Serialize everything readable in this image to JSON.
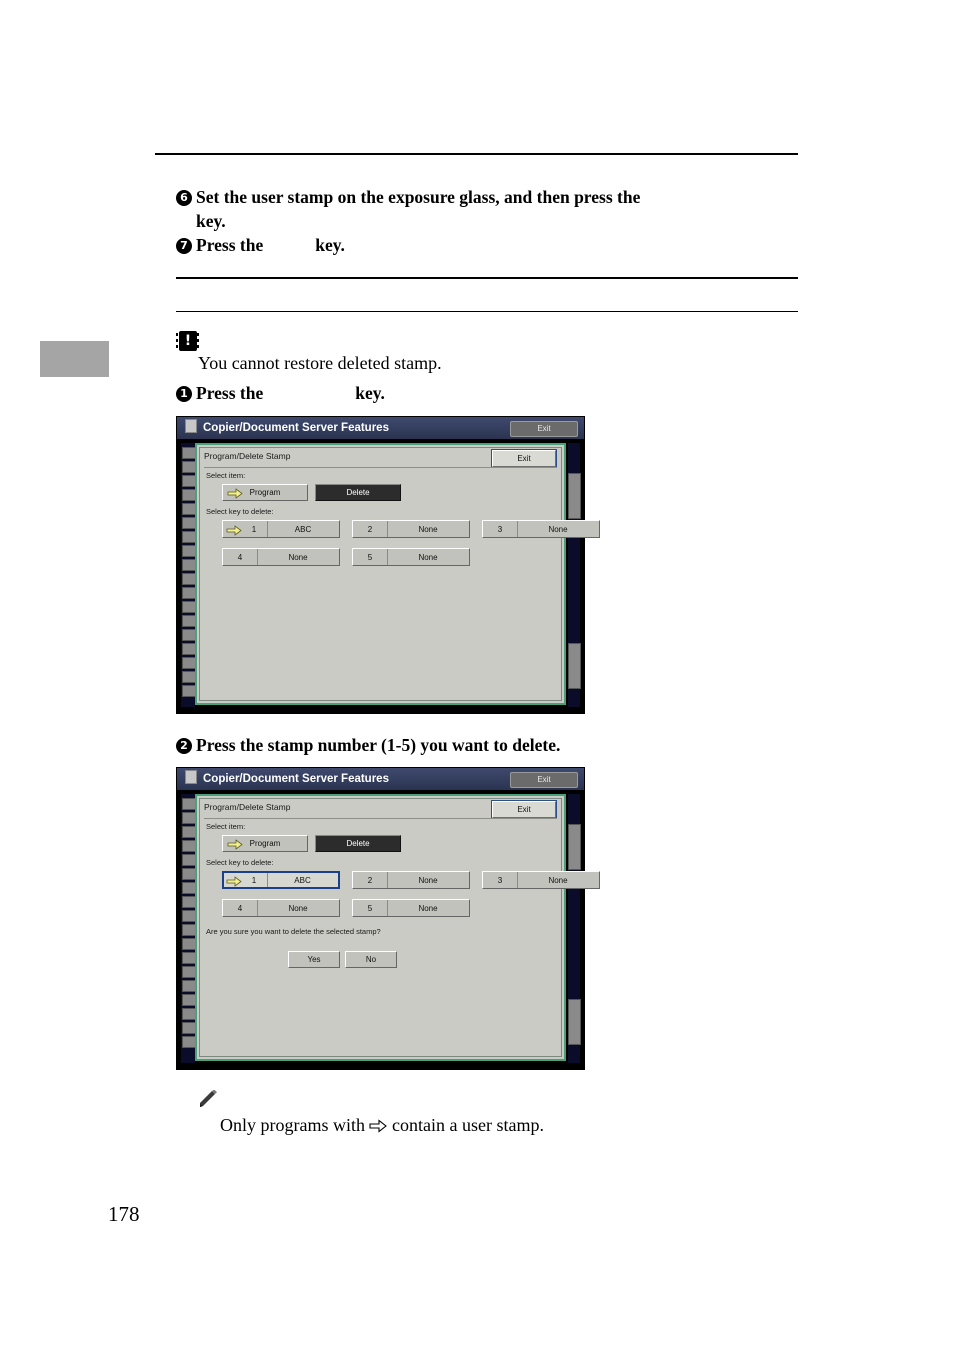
{
  "page": {
    "number": "178"
  },
  "steps": {
    "step6": {
      "marker": "6",
      "text_before": "Set the user stamp on the exposure glass, and then press the",
      "text_after": "key."
    },
    "step7": {
      "marker": "7",
      "text_before": "Press the",
      "text_after": "key."
    },
    "step1": {
      "marker": "1",
      "text_before": "Press the",
      "text_after": "key."
    },
    "step2": {
      "marker": "2",
      "text": "Press the stamp number (1-5) you want to delete."
    }
  },
  "important": {
    "icon": "important-icon",
    "text": "You cannot restore deleted stamp."
  },
  "note": {
    "icon": "pencil-note-icon",
    "text_before": "Only programs with",
    "inline_icon": "arrow-stamp-icon",
    "text_after": "contain a user stamp."
  },
  "panel1": {
    "titlebar": {
      "icon": "document-icon",
      "title": "Copier/Document Server Features",
      "exit_label": "Exit"
    },
    "screen": {
      "title": "Program/Delete Stamp",
      "exit_label": "Exit",
      "select_item_label": "Select item:",
      "program_label": "Program",
      "delete_label": "Delete",
      "select_key_label": "Select key to delete:",
      "keys": [
        {
          "num": "1",
          "name": "ABC",
          "selected": false,
          "has_arrow": true
        },
        {
          "num": "2",
          "name": "None",
          "selected": false,
          "has_arrow": false
        },
        {
          "num": "3",
          "name": "None",
          "selected": false,
          "has_arrow": false
        },
        {
          "num": "4",
          "name": "None",
          "selected": false,
          "has_arrow": false
        },
        {
          "num": "5",
          "name": "None",
          "selected": false,
          "has_arrow": false
        }
      ]
    }
  },
  "panel2": {
    "titlebar": {
      "icon": "document-icon",
      "title": "Copier/Document Server Features",
      "exit_label": "Exit"
    },
    "screen": {
      "title": "Program/Delete Stamp",
      "exit_label": "Exit",
      "select_item_label": "Select item:",
      "program_label": "Program",
      "delete_label": "Delete",
      "select_key_label": "Select key to delete:",
      "keys": [
        {
          "num": "1",
          "name": "ABC",
          "selected": true,
          "has_arrow": true
        },
        {
          "num": "2",
          "name": "None",
          "selected": false,
          "has_arrow": false
        },
        {
          "num": "3",
          "name": "None",
          "selected": false,
          "has_arrow": false
        },
        {
          "num": "4",
          "name": "None",
          "selected": false,
          "has_arrow": false
        },
        {
          "num": "5",
          "name": "None",
          "selected": false,
          "has_arrow": false
        }
      ],
      "confirm_text": "Are you sure you want to delete the selected stamp?",
      "yes_label": "Yes",
      "no_label": "No"
    }
  },
  "colors": {
    "screen_bg": "#c9cbc4",
    "screen_border": "#49a07a",
    "titlebar": "#2b3350",
    "accent_blue": "#1b3f88",
    "side_tab": "#a5a5a5"
  }
}
